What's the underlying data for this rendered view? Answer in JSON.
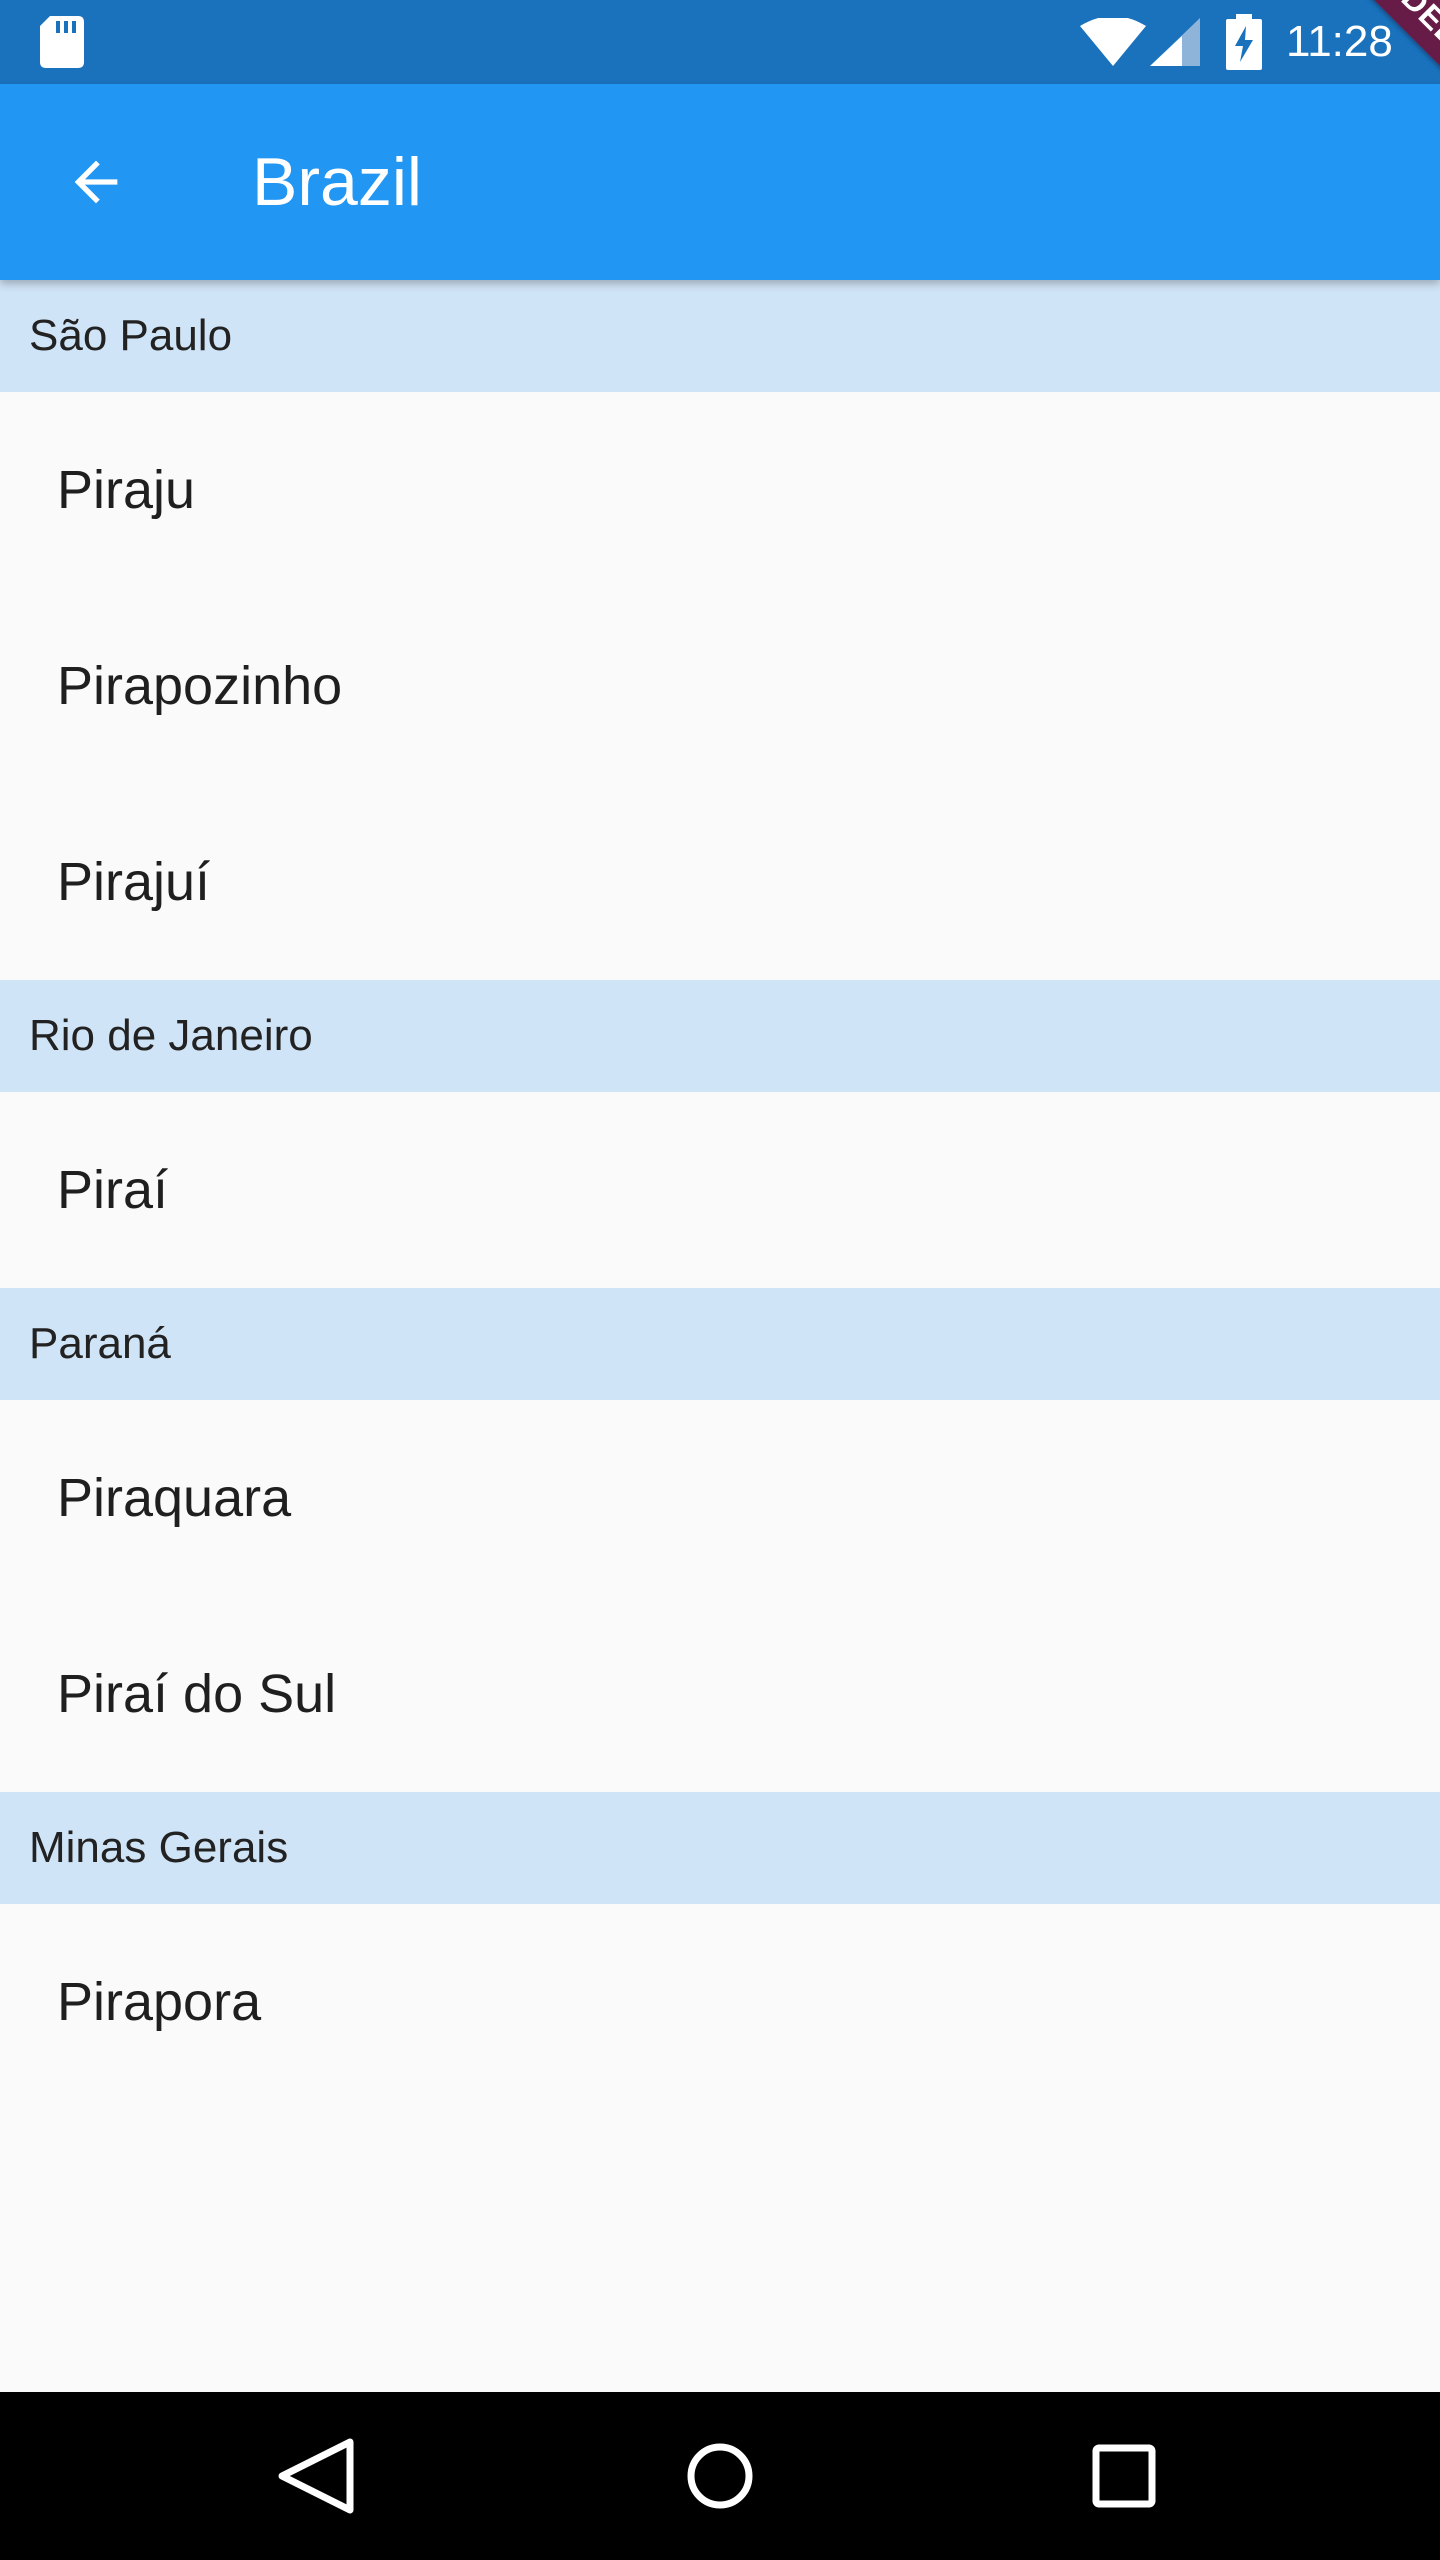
{
  "status_bar": {
    "time": "11:28",
    "icons": [
      "sd-card-icon",
      "wifi-icon",
      "signal-icon",
      "battery-charging-icon"
    ]
  },
  "app_bar": {
    "title": "Brazil",
    "back_icon": "arrow-back-icon",
    "color": "#2196F3"
  },
  "debug_banner": "DEBUG",
  "sections": [
    {
      "header": "São Paulo",
      "items": [
        "Piraju",
        "Pirapozinho",
        "Pirajuí"
      ]
    },
    {
      "header": "Rio de Janeiro",
      "items": [
        "Piraí"
      ]
    },
    {
      "header": "Paraná",
      "items": [
        "Piraquara",
        "Piraí do Sul"
      ]
    },
    {
      "header": "Minas Gerais",
      "items": [
        "Pirapora"
      ]
    }
  ],
  "colors": {
    "status_bar": "#1A72BD",
    "section_header_bg": "#D0E4F7",
    "page_bg": "#FAFAFA",
    "nav_bar": "#000000"
  },
  "nav_bar": {
    "icons": [
      "nav-back-icon",
      "nav-home-icon",
      "nav-recents-icon"
    ]
  }
}
